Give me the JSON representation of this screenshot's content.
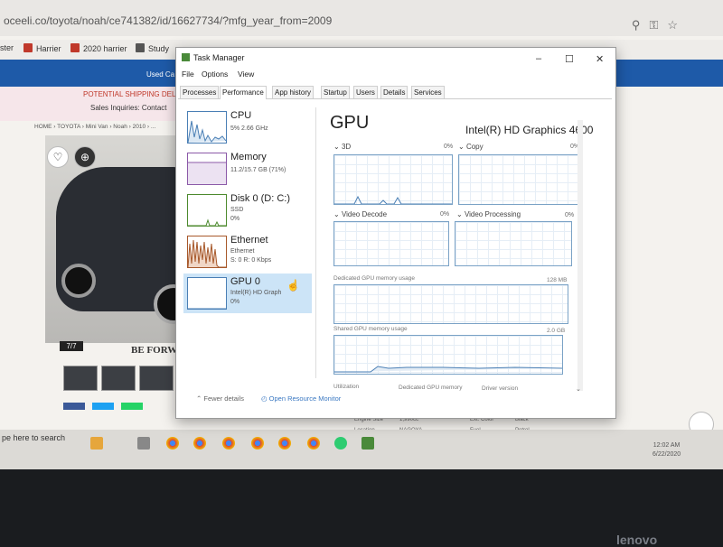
{
  "browser": {
    "url": "oceeli.co/toyota/noah/ce741382/id/16627734/?mfg_year_from=2009",
    "bookmarks": [
      "ster",
      "Harrier",
      "2020 harrier",
      "Study"
    ]
  },
  "website": {
    "shipping": "POTENTIAL SHIPPING DELA",
    "sales": "Sales Inquiries: Contact",
    "breadcrumb": "HOME  ›  TOYOTA  ›  Mini Van  ›  Noah  ›  2010  ›  ...",
    "counter": "7/7",
    "banner": "BE FORWAR",
    "used_car": "Used Ca",
    "specs": [
      "Engine Size",
      "1,990cc",
      "Ext. Color",
      "Black",
      "Location",
      "NAGOYA",
      "Fuel",
      "Petrol"
    ]
  },
  "taskbar": {
    "search": "pe here to search",
    "time": "12:02 AM",
    "date": "6/22/2020"
  },
  "bezel_brand": "lenovo",
  "task_manager": {
    "title": "Task Manager",
    "menu": [
      "File",
      "Options",
      "View"
    ],
    "tabs": [
      "Processes",
      "Performance",
      "App history",
      "Startup",
      "Users",
      "Details",
      "Services"
    ],
    "active_tab": "Performance",
    "sidebar": [
      {
        "name": "CPU",
        "sub1": "5% 2.66 GHz",
        "sub2": ""
      },
      {
        "name": "Memory",
        "sub1": "11.2/15.7 GB (71%)",
        "sub2": ""
      },
      {
        "name": "Disk 0 (D: C:)",
        "sub1": "SSD",
        "sub2": "0%"
      },
      {
        "name": "Ethernet",
        "sub1": "Ethernet",
        "sub2": "S: 0 R: 0 Kbps"
      },
      {
        "name": "GPU 0",
        "sub1": "Intel(R) HD Graph",
        "sub2": "0%"
      }
    ],
    "gpu": {
      "title": "GPU",
      "name": "Intel(R) HD Graphics 4600",
      "engines": [
        {
          "label": "3D",
          "pct": "0%"
        },
        {
          "label": "Copy",
          "pct": "0%"
        },
        {
          "label": "Video Decode",
          "pct": "0%"
        },
        {
          "label": "Video Processing",
          "pct": "0%"
        }
      ],
      "dedicated_label": "Dedicated GPU memory usage",
      "dedicated_value": "128 MB",
      "shared_label": "Shared GPU memory usage",
      "shared_value": "2.0 GB",
      "footer": [
        "Utilization",
        "Dedicated GPU memory",
        "Driver version"
      ]
    },
    "fewer_details": "Fewer details",
    "open_monitor": "Open Resource Monitor",
    "colors": {
      "cpu": "#4a7fb5",
      "memory": "#8b59a8",
      "disk": "#4d8a2e",
      "ethernet": "#a7582a",
      "selected": "#cce4f7"
    }
  }
}
